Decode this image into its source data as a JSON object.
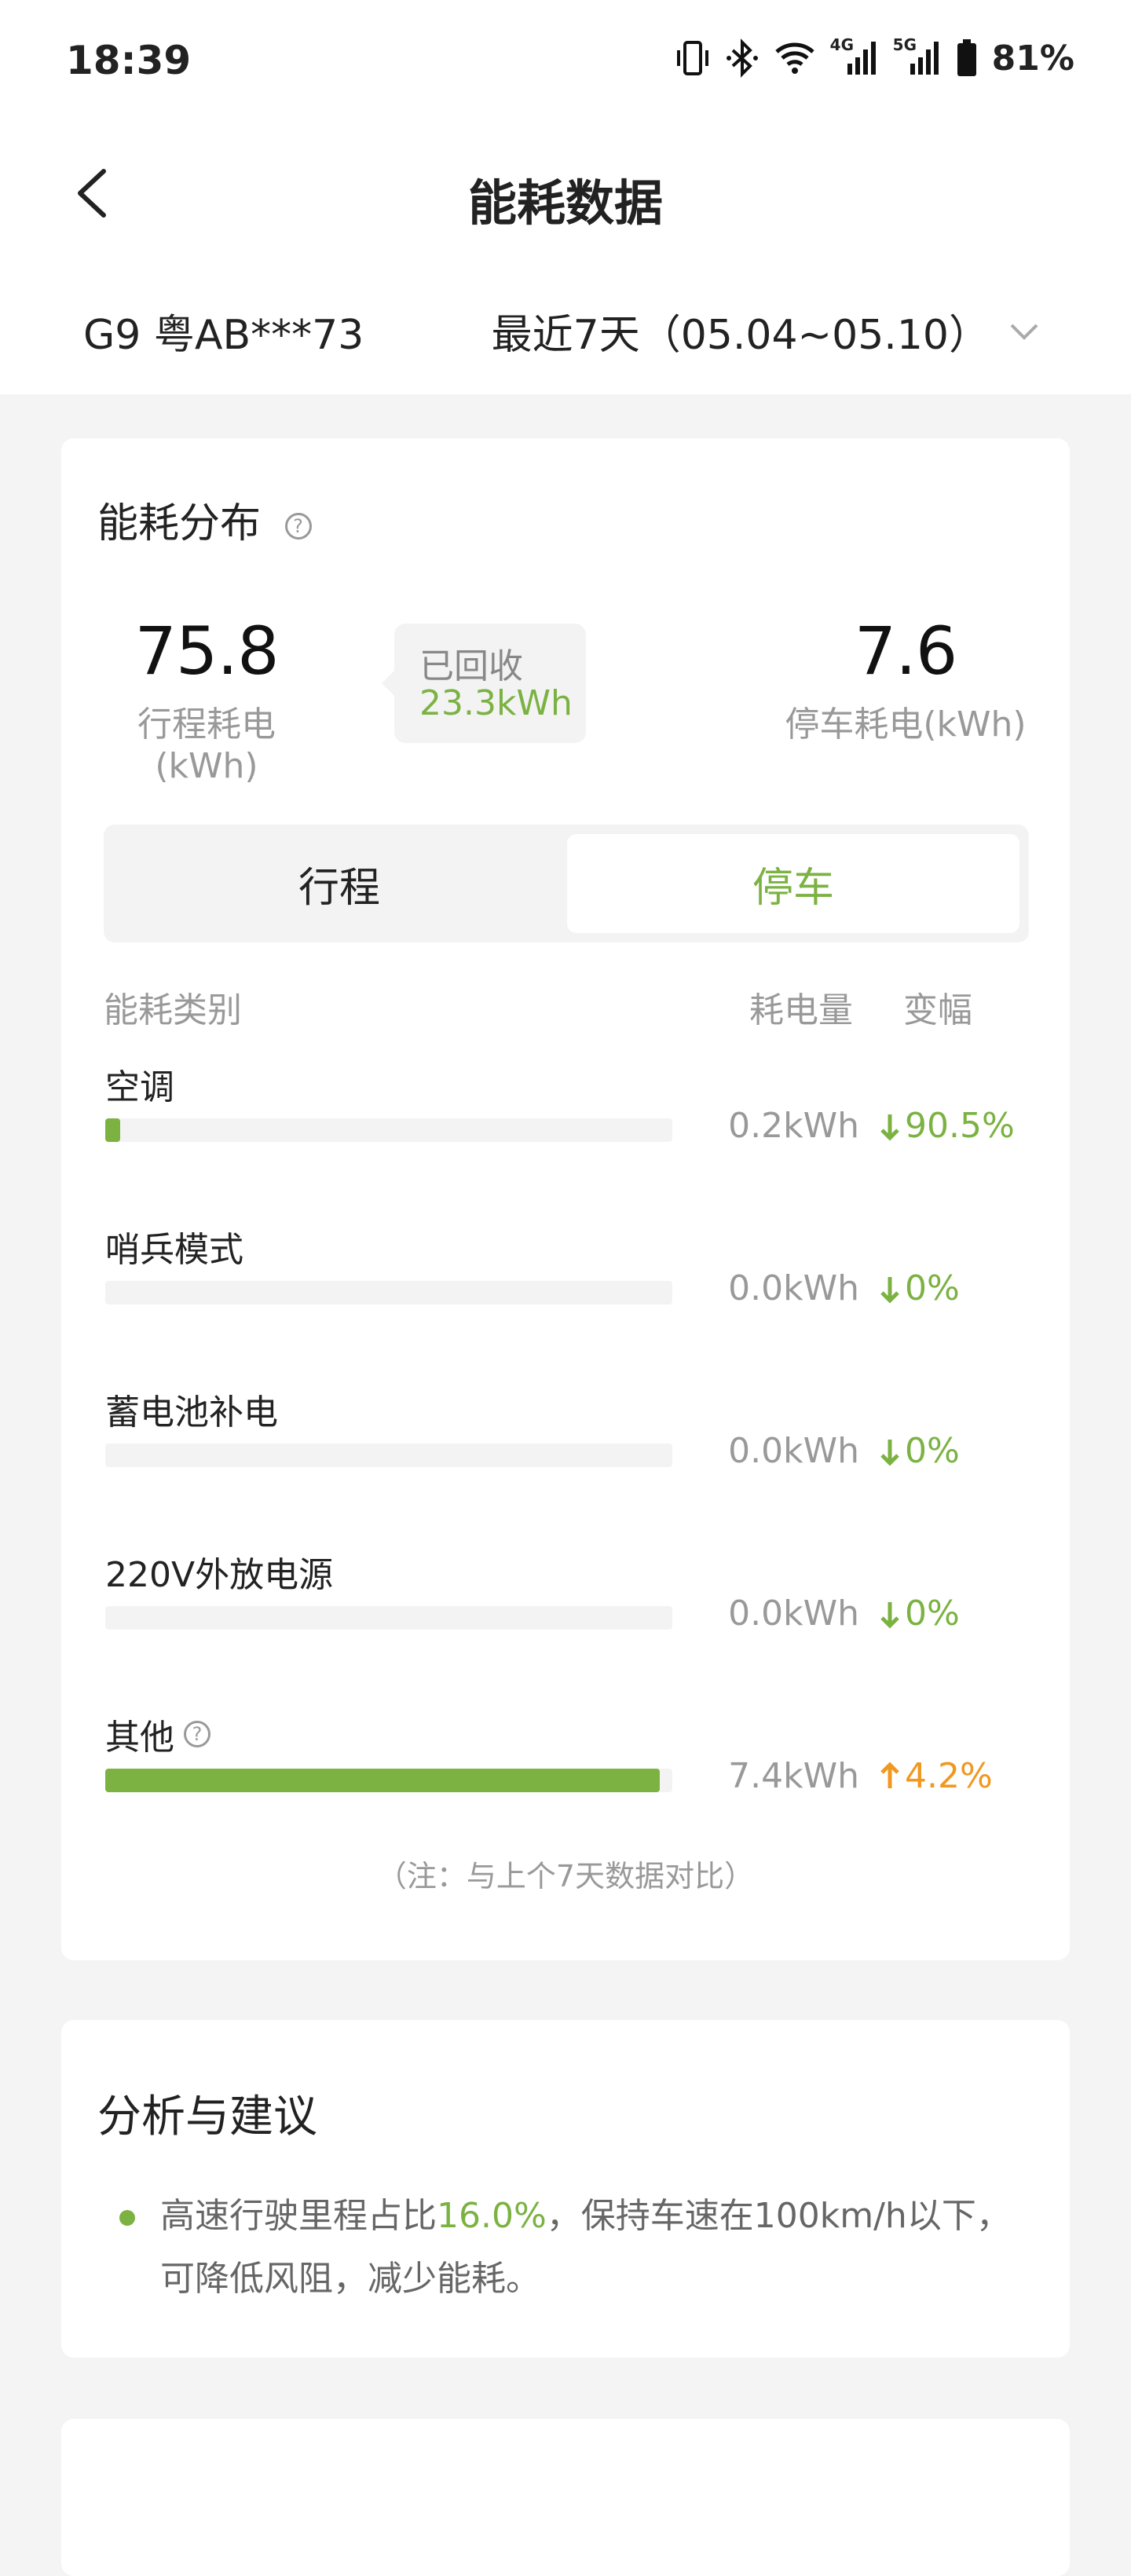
{
  "status_bar": {
    "time": "18:39",
    "net1": "4G",
    "net2": "5G",
    "battery": "81%"
  },
  "nav": {
    "title": "能耗数据",
    "back_icon": "chevron-left-icon"
  },
  "subbar": {
    "vehicle": "G9 粤AB***73",
    "range": "最近7天（05.04~05.10）"
  },
  "distribution": {
    "title": "能耗分布",
    "trip_value": "75.8",
    "trip_label": "行程耗电(kWh)",
    "recovered_label": "已回收",
    "recovered_value": "23.3kWh",
    "park_value": "7.6",
    "park_label": "停车耗电(kWh)",
    "tabs": [
      {
        "label": "行程",
        "selected": false
      },
      {
        "label": "停车",
        "selected": true
      }
    ],
    "headers": {
      "category": "能耗类别",
      "usage": "耗电量",
      "change": "变幅"
    },
    "rows": [
      {
        "name": "空调",
        "value": "0.2kWh",
        "change": "90.5%",
        "direction": "down",
        "share": 0.027,
        "help": false
      },
      {
        "name": "哨兵模式",
        "value": "0.0kWh",
        "change": "0%",
        "direction": "down",
        "share": 0.0,
        "help": false
      },
      {
        "name": "蓄电池补电",
        "value": "0.0kWh",
        "change": "0%",
        "direction": "down",
        "share": 0.0,
        "help": false
      },
      {
        "name": "220V外放电源",
        "value": "0.0kWh",
        "change": "0%",
        "direction": "down",
        "share": 0.0,
        "help": false
      },
      {
        "name": "其他",
        "value": "7.4kWh",
        "change": "4.2%",
        "direction": "up",
        "share": 0.978,
        "help": true
      }
    ],
    "note": "（注：与上个7天数据对比）"
  },
  "analysis": {
    "title": "分析与建议",
    "tip_prefix": "高速行驶里程占比",
    "tip_highlight": "16.0%",
    "tip_suffix": "，保持车速在100km/h以下，可降低风阻，减少能耗。"
  },
  "colors": {
    "accent_green": "#7bb242",
    "accent_orange": "#f0981f",
    "muted": "#999999"
  }
}
